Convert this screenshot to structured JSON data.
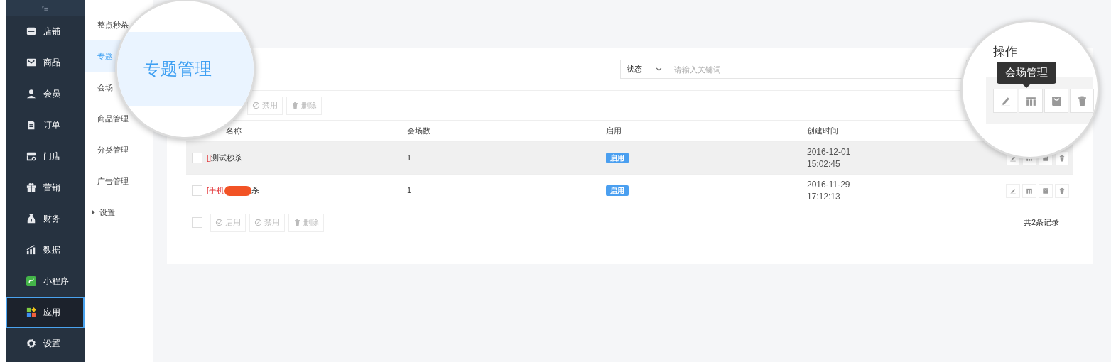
{
  "sidebar": {
    "items": [
      {
        "label": "店铺",
        "selected": false
      },
      {
        "label": "商品",
        "selected": false
      },
      {
        "label": "会员",
        "selected": false
      },
      {
        "label": "订单",
        "selected": false
      },
      {
        "label": "门店",
        "selected": false
      },
      {
        "label": "营销",
        "selected": false
      },
      {
        "label": "财务",
        "selected": false
      },
      {
        "label": "数据",
        "selected": false
      },
      {
        "label": "小程序",
        "selected": false
      },
      {
        "label": "应用",
        "selected": true
      },
      {
        "label": "设置",
        "selected": false
      }
    ]
  },
  "subnav": {
    "items": [
      {
        "label": "整点秒杀",
        "selected": false
      },
      {
        "label": "专题",
        "selected": true
      },
      {
        "label": "会场",
        "selected": false
      },
      {
        "label": "商品管理",
        "selected": false
      },
      {
        "label": "分类管理",
        "selected": false
      },
      {
        "label": "广告管理",
        "selected": false
      },
      {
        "label": "设置",
        "selected": false,
        "expandable": true
      }
    ]
  },
  "search": {
    "select": "状态",
    "placeholder": "请输入关键词"
  },
  "toolbar": [
    {
      "label": "禁用",
      "kind": "disable"
    },
    {
      "label": "删除",
      "kind": "delete"
    }
  ],
  "table": {
    "columns": [
      "名称",
      "会场数",
      "启用",
      "创建时间"
    ],
    "rows": [
      {
        "checked": false,
        "highlighted": true,
        "tag": "[]",
        "name": "测试秒杀",
        "redacted": false,
        "venues": "1",
        "status": "启用",
        "date": "2016-12-01",
        "time": "15:02:45"
      },
      {
        "checked": false,
        "highlighted": false,
        "tag": "[手机",
        "name": "杀",
        "redacted": true,
        "venues": "1",
        "status": "启用",
        "date": "2016-11-29",
        "time": "17:12:13"
      }
    ]
  },
  "footer": {
    "checked": false,
    "buttons": [
      {
        "label": "启用",
        "kind": "enable"
      },
      {
        "label": "禁用",
        "kind": "disable"
      },
      {
        "label": "删除",
        "kind": "delete"
      }
    ],
    "total": "共2条记录"
  },
  "magnifiers": [
    {
      "kind": "menu",
      "text": "专题管理"
    },
    {
      "kind": "actions",
      "header": "操作",
      "tooltip": "会场管理"
    }
  ]
}
